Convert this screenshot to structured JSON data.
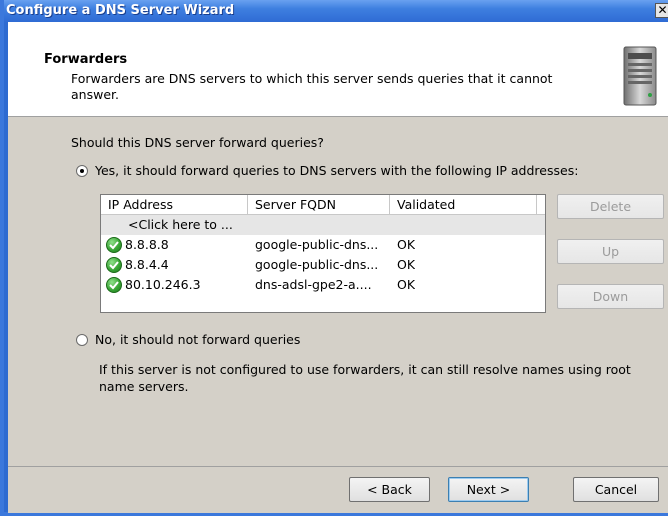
{
  "window": {
    "title": "Configure a DNS Server Wizard",
    "close_glyph": "✕"
  },
  "header": {
    "title": "Forwarders",
    "description": "Forwarders are DNS servers to which this server sends queries that it cannot answer."
  },
  "body": {
    "question": "Should this DNS server forward queries?",
    "option_yes": {
      "label": "Yes, it should forward queries to DNS servers with the following IP addresses:",
      "checked": true
    },
    "option_no": {
      "label": "No, it should not forward queries",
      "checked": false
    },
    "note": "If this server is not configured to use forwarders, it can still resolve names using root name servers."
  },
  "table": {
    "columns": [
      "IP Address",
      "Server FQDN",
      "Validated"
    ],
    "placeholder": "<Click here to ...",
    "rows": [
      {
        "ip": "8.8.8.8",
        "fqdn": "google-public-dns...",
        "validated": "OK",
        "status_icon": "check-circle-icon"
      },
      {
        "ip": "8.8.4.4",
        "fqdn": "google-public-dns...",
        "validated": "OK",
        "status_icon": "check-circle-icon"
      },
      {
        "ip": "80.10.246.3",
        "fqdn": "dns-adsl-gpe2-a....",
        "validated": "OK",
        "status_icon": "check-circle-icon"
      }
    ]
  },
  "side_buttons": {
    "delete": "Delete",
    "up": "Up",
    "down": "Down"
  },
  "footer": {
    "back": "< Back",
    "next": "Next >",
    "cancel": "Cancel"
  },
  "colors": {
    "titlebar": "#3e7fe0",
    "dialog_bg": "#d4d0c8",
    "ok_green": "#3aa637"
  }
}
